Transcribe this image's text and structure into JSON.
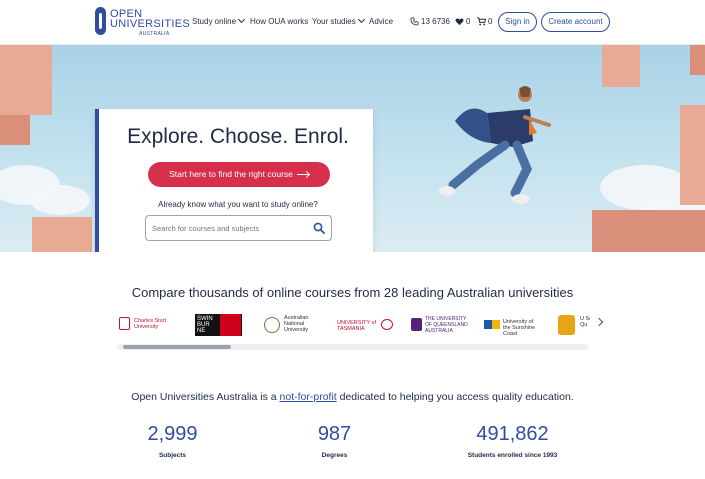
{
  "brand": {
    "line1": "OPEN",
    "line2": "UNIVERSITIES",
    "sub": "AUSTRALIA"
  },
  "nav": [
    {
      "label": "Study online",
      "dropdown": true
    },
    {
      "label": "How OUA works",
      "dropdown": false
    },
    {
      "label": "Your studies",
      "dropdown": true
    },
    {
      "label": "Advice",
      "dropdown": false
    }
  ],
  "utility": {
    "phone": "13 6736",
    "favourites_count": "0",
    "cart_count": "0"
  },
  "auth": {
    "sign_in": "Sign in",
    "create_account": "Create account"
  },
  "hero": {
    "title": "Explore. Choose. Enrol.",
    "cta": "Start here to find the right course",
    "already": "Already know what you want to study online?",
    "search_placeholder": "Search for courses and subjects"
  },
  "compare": {
    "title": "Compare thousands of online courses from 28 leading Australian universities",
    "universities": [
      {
        "name": "Charles Sturt University",
        "color": "#c8102e"
      },
      {
        "name": "SWIN BUR NE",
        "color": "#d0021b"
      },
      {
        "name": "Australian National University",
        "color": "#8a6d3b"
      },
      {
        "name": "UNIVERSITY of TASMANIA",
        "color": "#c8102e"
      },
      {
        "name": "THE UNIVERSITY OF QUEENSLAND AUSTRALIA",
        "color": "#51247a"
      },
      {
        "name": "University of the Sunshine Coast",
        "color": "#1e5aa8"
      },
      {
        "name": "U Sc Qu",
        "color": "#e8a317"
      }
    ]
  },
  "intro": {
    "before": "Open Universities Australia is a ",
    "link": "not-for-profit",
    "after": " dedicated to helping you access quality education."
  },
  "stats": [
    {
      "value": "2,999",
      "label": "Subjects"
    },
    {
      "value": "987",
      "label": "Degrees"
    },
    {
      "value": "491,862",
      "label": "Students enrolled since 1993"
    }
  ],
  "colors": {
    "brand_blue": "#2f4da1",
    "cta_red": "#d62f4b",
    "text_dark": "#1f2a44"
  }
}
